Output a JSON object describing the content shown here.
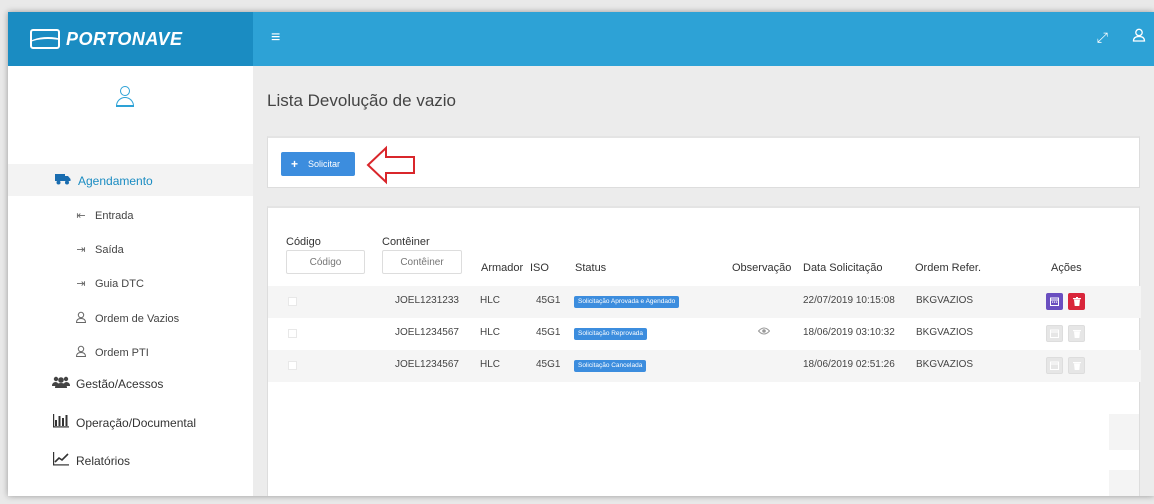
{
  "brand": {
    "name": "PORTONAVE"
  },
  "topbar": {
    "menu_icon": "hamburger-icon",
    "expand_icon": "expand-icon",
    "user_icon": "user-icon"
  },
  "sidebar": {
    "user_icon": "user-icon",
    "items": [
      {
        "label": "Agendamento",
        "icon": "truck-icon",
        "active": true,
        "children": [
          {
            "label": "Entrada",
            "icon": "sign-in-icon"
          },
          {
            "label": "Saída",
            "icon": "sign-out-icon"
          },
          {
            "label": "Guia DTC",
            "icon": "sign-out-icon"
          },
          {
            "label": "Ordem de Vazios",
            "icon": "user-icon"
          },
          {
            "label": "Ordem PTI",
            "icon": "user-icon"
          }
        ]
      },
      {
        "label": "Gestão/Acessos",
        "icon": "users-icon"
      },
      {
        "label": "Operação/Documental",
        "icon": "bar-chart-icon"
      },
      {
        "label": "Relatórios",
        "icon": "line-chart-icon"
      }
    ]
  },
  "main": {
    "title": "Lista Devolução de vazio",
    "solicitar_label": "Solicitar",
    "table": {
      "headers": {
        "codigo": "Código",
        "conteiner": "Contêiner",
        "armador": "Armador",
        "iso": "ISO",
        "status": "Status",
        "observacao": "Observação",
        "data": "Data Solicitação",
        "ordem": "Ordem Refer.",
        "acoes": "Ações"
      },
      "filters": {
        "codigo_placeholder": "Código",
        "conteiner_placeholder": "Contêiner"
      },
      "rows": [
        {
          "conteiner": "JOEL1231233",
          "armador": "HLC",
          "iso": "45G1",
          "status": "Solicitação Aprovada e Agendado",
          "observacao": "",
          "data": "22/07/2019 10:15:08",
          "ordem": "BKGVAZIOS",
          "actions_enabled": true
        },
        {
          "conteiner": "JOEL1234567",
          "armador": "HLC",
          "iso": "45G1",
          "status": "Solicitação Reprovada",
          "observacao": "eye-icon",
          "data": "18/06/2019 03:10:32",
          "ordem": "BKGVAZIOS",
          "actions_enabled": false
        },
        {
          "conteiner": "JOEL1234567",
          "armador": "HLC",
          "iso": "45G1",
          "status": "Solicitação Cancelada",
          "observacao": "",
          "data": "18/06/2019 02:51:26",
          "ordem": "BKGVAZIOS",
          "actions_enabled": false
        }
      ]
    }
  },
  "colors": {
    "brand": "#1a8cc2",
    "navbar": "#2da2d6",
    "primary_button": "#3c8dde",
    "danger": "#d9263b",
    "purple": "#6a4fc0",
    "annotation_arrow": "#d9262b"
  }
}
